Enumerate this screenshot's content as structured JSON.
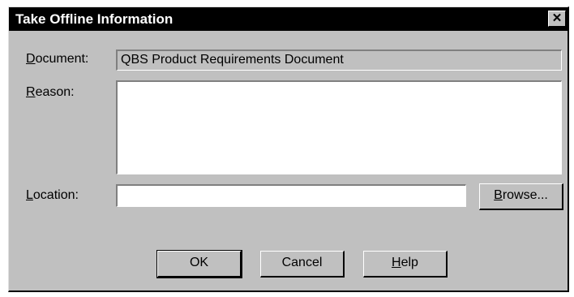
{
  "dialog": {
    "title": "Take Offline Information",
    "close_symbol": "✕",
    "close_icon": "close-icon"
  },
  "fields": {
    "document_label_mnemonic": "D",
    "document_label_rest": "ocument:",
    "document_value": "QBS Product Requirements Document",
    "reason_label_mnemonic": "R",
    "reason_label_rest": "eason:",
    "reason_value": "",
    "location_label_mnemonic": "L",
    "location_label_rest": "ocation:",
    "location_value": ""
  },
  "buttons": {
    "browse_mnemonic": "B",
    "browse_rest": "rowse...",
    "ok_label": "OK",
    "cancel_label": "Cancel",
    "help_mnemonic": "H",
    "help_rest": "elp"
  },
  "colors": {
    "face": "#c0c0c0",
    "titlebar": "#000000",
    "title_text": "#ffffff"
  }
}
